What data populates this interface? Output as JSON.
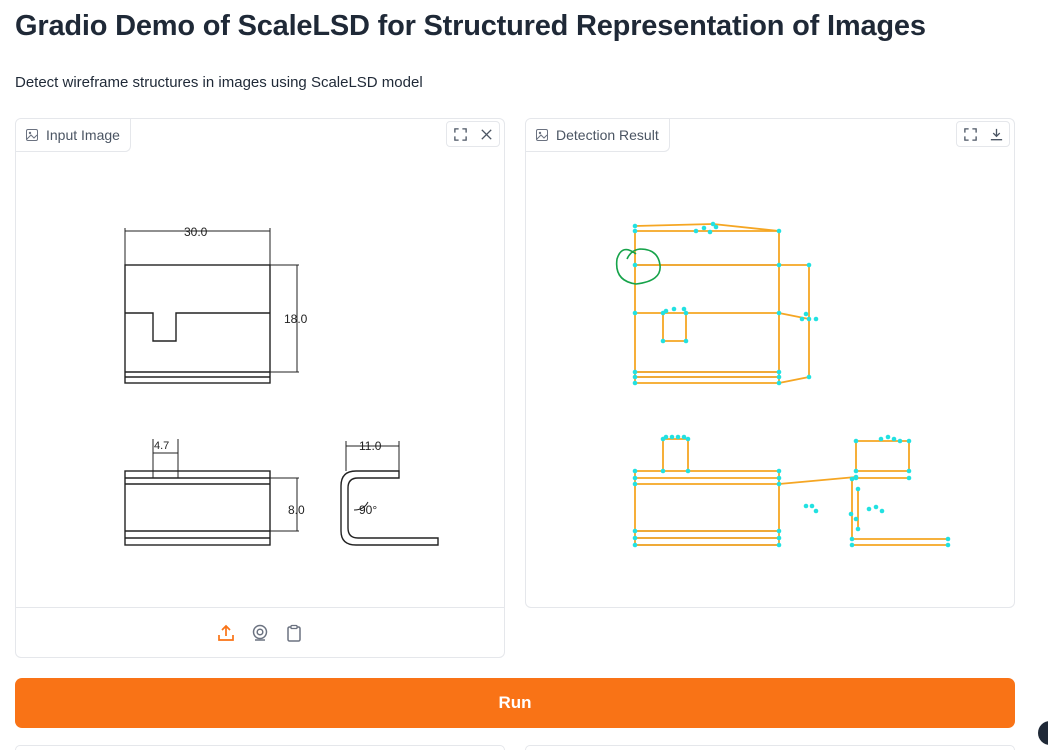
{
  "header": {
    "title": "Gradio Demo of ScaleLSD for Structured Representation of Images",
    "description": "Detect wireframe structures in images using ScaleLSD model"
  },
  "input_panel": {
    "label": "Input Image",
    "icon": "image-icon",
    "actions": [
      "fullscreen-icon",
      "close-icon"
    ],
    "sources": [
      "upload-icon",
      "webcam-icon",
      "clipboard-icon"
    ],
    "drawing": {
      "dim_top": "30.0",
      "dim_right": "18.0",
      "dim_small": "4.7",
      "dim_bottom": "8.0",
      "dim_clip": "11.0",
      "angle": "90°"
    }
  },
  "result_panel": {
    "label": "Detection Result",
    "icon": "image-icon",
    "actions": [
      "fullscreen-icon",
      "download-icon"
    ]
  },
  "run_button": {
    "label": "Run"
  },
  "colors": {
    "accent": "#f97316",
    "wireframe_line": "#f5a623",
    "junction": "#22e1e1",
    "annotation": "#16a34a",
    "border": "#e5e7eb"
  }
}
